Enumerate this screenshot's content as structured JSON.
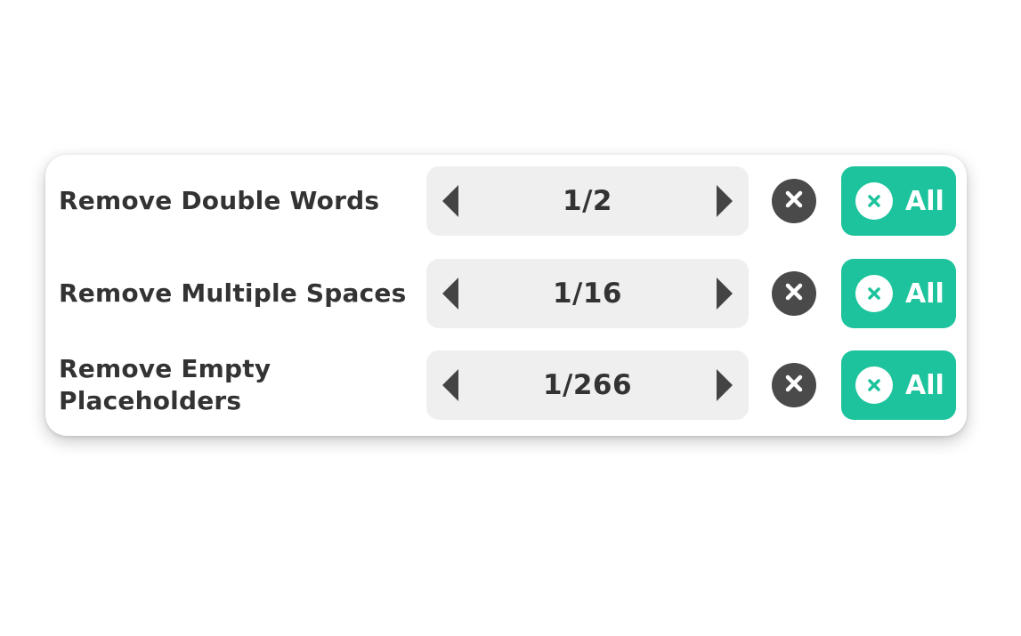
{
  "colors": {
    "accent": "#1cc39c",
    "stepper_bg": "#efefef",
    "text": "#333333",
    "clear_button": "#4a4a4a"
  },
  "rows": [
    {
      "label": "Remove Double Words",
      "counter": "1/2",
      "prev_icon": "caret-left-icon",
      "next_icon": "caret-right-icon",
      "clear_icon": "close-circle-icon",
      "all_icon": "close-circle-icon",
      "all_label": "All"
    },
    {
      "label": "Remove Multiple Spaces",
      "counter": "1/16",
      "prev_icon": "caret-left-icon",
      "next_icon": "caret-right-icon",
      "clear_icon": "close-circle-icon",
      "all_icon": "close-circle-icon",
      "all_label": "All"
    },
    {
      "label": "Remove Empty Placeholders",
      "counter": "1/266",
      "prev_icon": "caret-left-icon",
      "next_icon": "caret-right-icon",
      "clear_icon": "close-circle-icon",
      "all_icon": "close-circle-icon",
      "all_label": "All"
    }
  ]
}
